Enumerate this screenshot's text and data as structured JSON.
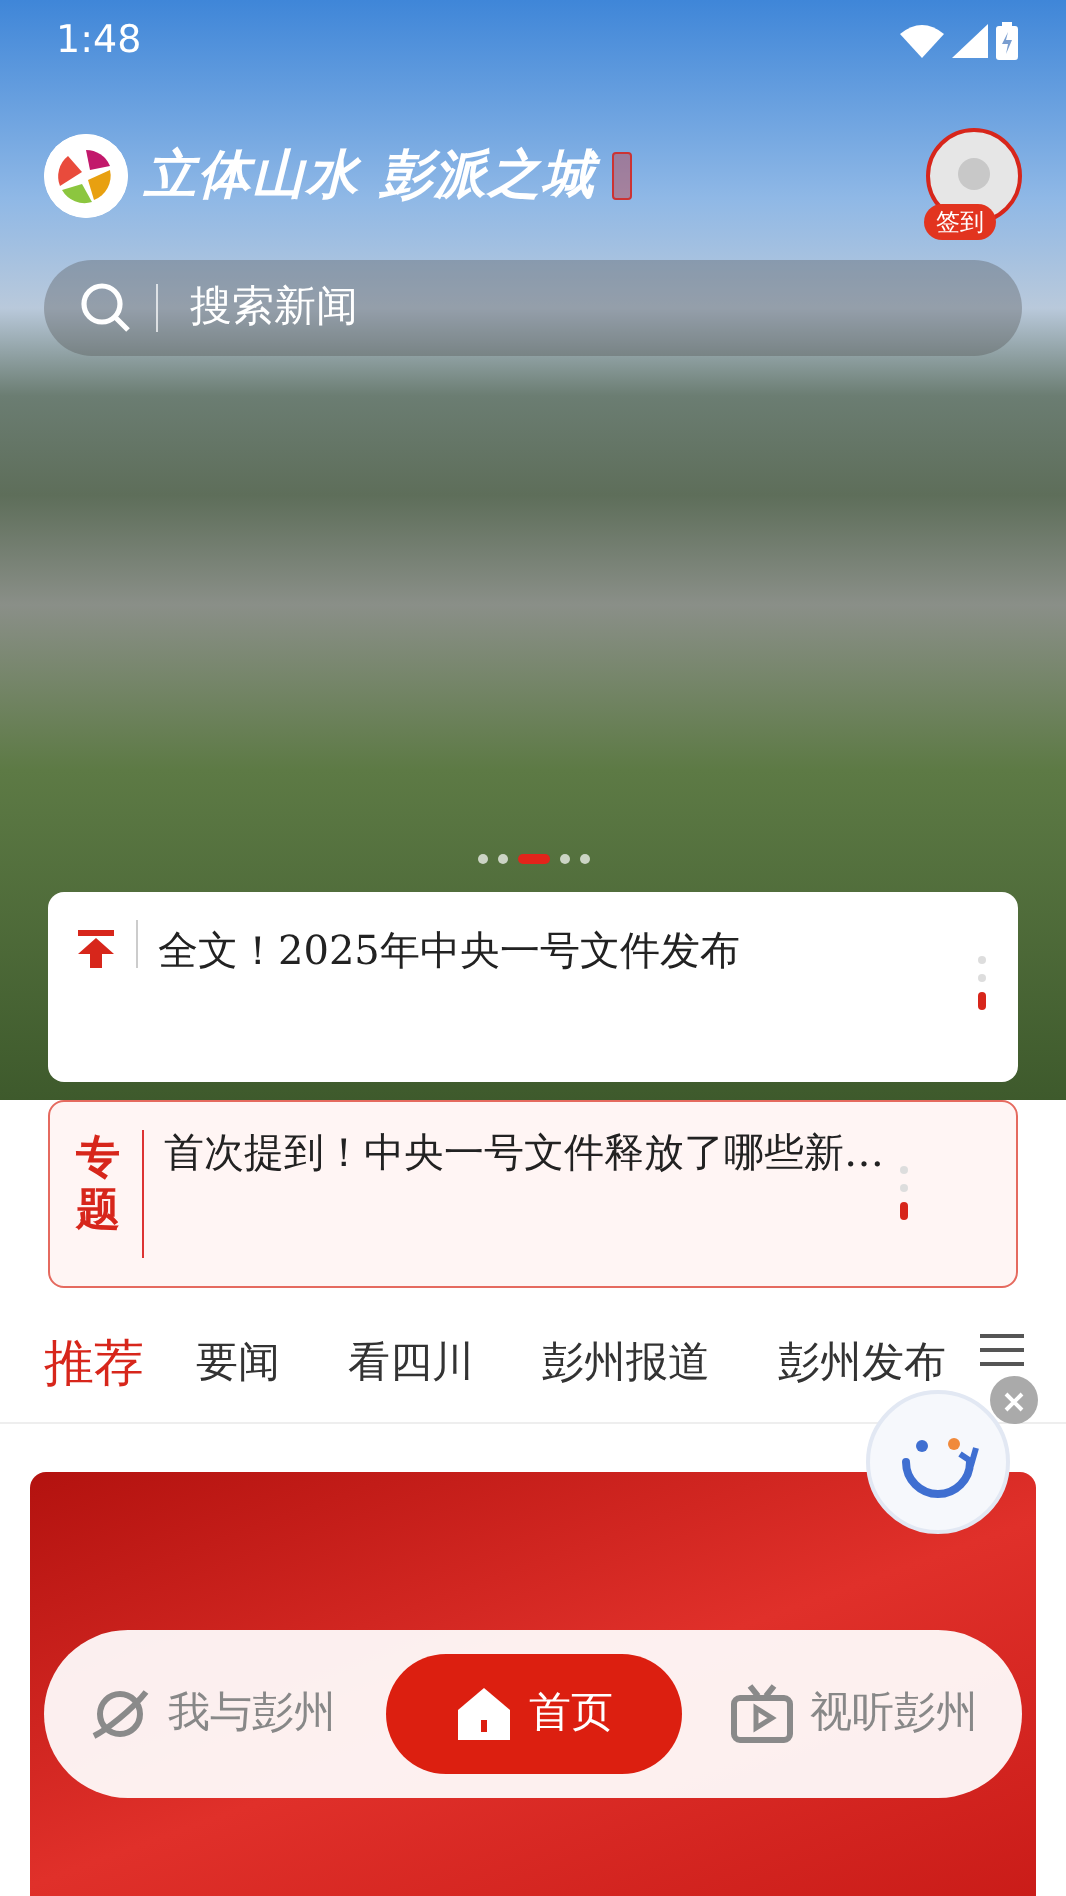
{
  "status_bar": {
    "time": "1:48"
  },
  "header": {
    "logo_text": "立体山水 彭派之城",
    "sign_in": "签到"
  },
  "search": {
    "placeholder": "搜索新闻"
  },
  "carousel": {
    "dots": [
      {
        "selected": false
      },
      {
        "selected": false
      },
      {
        "selected": true
      },
      {
        "selected": false
      },
      {
        "selected": false
      }
    ]
  },
  "pinned": {
    "title": "全文！2025年中央一号文件发布",
    "pages": [
      {
        "selected": false
      },
      {
        "selected": false
      },
      {
        "selected": true
      }
    ]
  },
  "topic": {
    "label": "专题",
    "title": "首次提到！中央一号文件释放了哪些新…",
    "pages": [
      {
        "selected": false
      },
      {
        "selected": false
      },
      {
        "selected": true
      }
    ]
  },
  "tabs": [
    {
      "label": "推荐",
      "selected": true
    },
    {
      "label": "要闻",
      "selected": false
    },
    {
      "label": "看四川",
      "selected": false
    },
    {
      "label": "彭州报道",
      "selected": false
    },
    {
      "label": "彭州发布",
      "selected": false
    }
  ],
  "bottom_nav": [
    {
      "label": "我与彭州",
      "kind": "planet",
      "selected": false
    },
    {
      "label": "首页",
      "kind": "home",
      "selected": true
    },
    {
      "label": "视听彭州",
      "kind": "tv",
      "selected": false
    }
  ]
}
